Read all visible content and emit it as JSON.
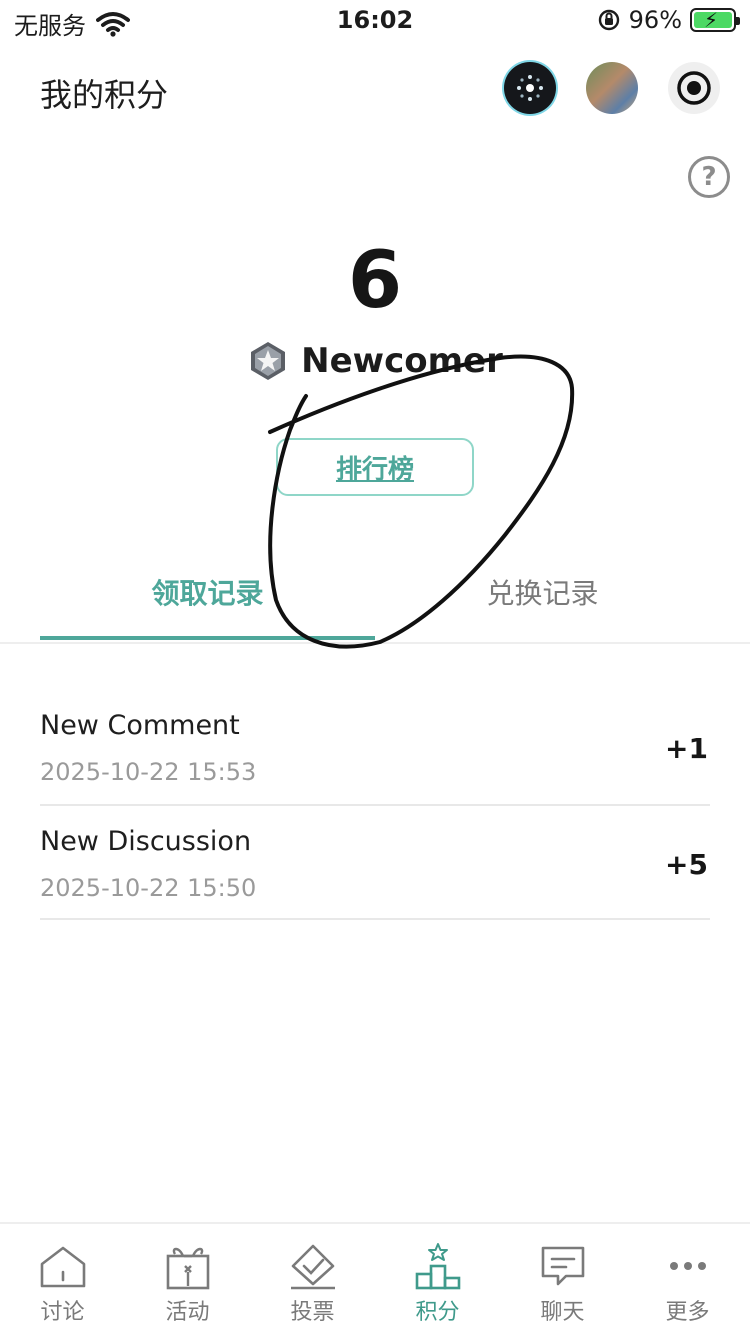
{
  "status_bar": {
    "carrier": "无服务",
    "time": "16:02",
    "battery": "96%"
  },
  "header": {
    "title": "我的积分",
    "icons": [
      "app-icon",
      "profile-photo",
      "record-icon"
    ]
  },
  "summary": {
    "points": "6",
    "level": "Newcomer",
    "ranking_button": "排行榜"
  },
  "tabs": [
    {
      "label": "领取记录",
      "active": true
    },
    {
      "label": "兑换记录",
      "active": false
    }
  ],
  "records": [
    {
      "title": "New Comment",
      "time": "2025-10-22 15:53",
      "points": "+1"
    },
    {
      "title": "New Discussion",
      "time": "2025-10-22 15:50",
      "points": "+5"
    }
  ],
  "bottom_nav": [
    {
      "label": "讨论",
      "icon": "home-icon"
    },
    {
      "label": "活动",
      "icon": "gift-icon"
    },
    {
      "label": "投票",
      "icon": "vote-icon"
    },
    {
      "label": "积分",
      "icon": "podium-icon",
      "active": true
    },
    {
      "label": "聊天",
      "icon": "chat-icon"
    },
    {
      "label": "更多",
      "icon": "more-icon"
    }
  ],
  "colors": {
    "accent": "#4ea79a",
    "accent_border": "#8fd6c8",
    "muted_text": "#7a7a7a",
    "time_text": "#9a9a9a",
    "battery_fill": "#4cd964"
  }
}
